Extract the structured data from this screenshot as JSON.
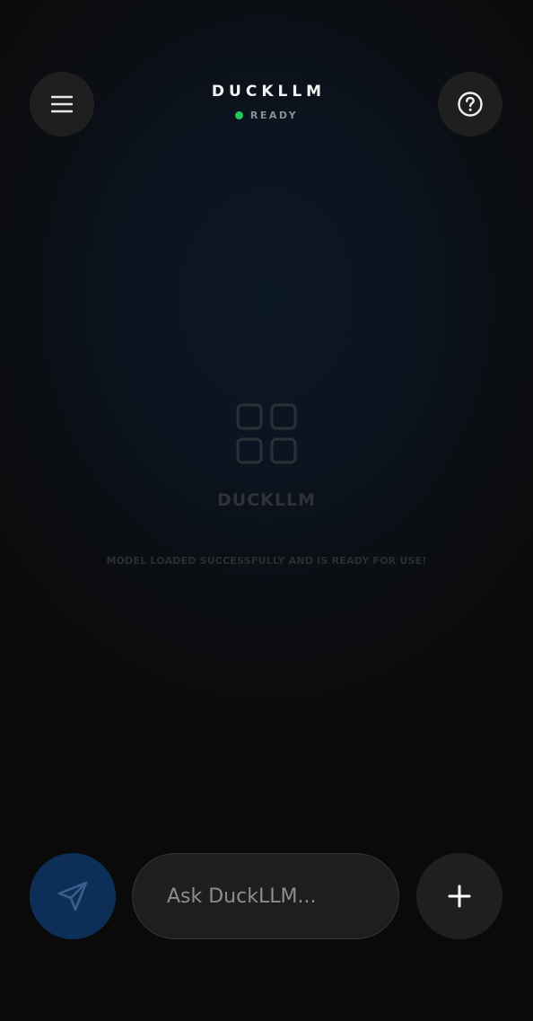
{
  "header": {
    "title": "DUCKLLM",
    "status": "READY",
    "status_color": "#22c55e",
    "menu_icon": "menu-icon",
    "help_icon": "help-circle-icon"
  },
  "empty_state": {
    "icon": "grid-icon",
    "title": "DUCKLLM",
    "message": "MODEL LOADED SUCCESSFULLY AND IS READY FOR USE!"
  },
  "composer": {
    "placeholder": "Ask DuckLLM...",
    "value": "",
    "send_icon": "send-icon",
    "add_icon": "plus-icon",
    "send_color": "#0c2e57"
  }
}
